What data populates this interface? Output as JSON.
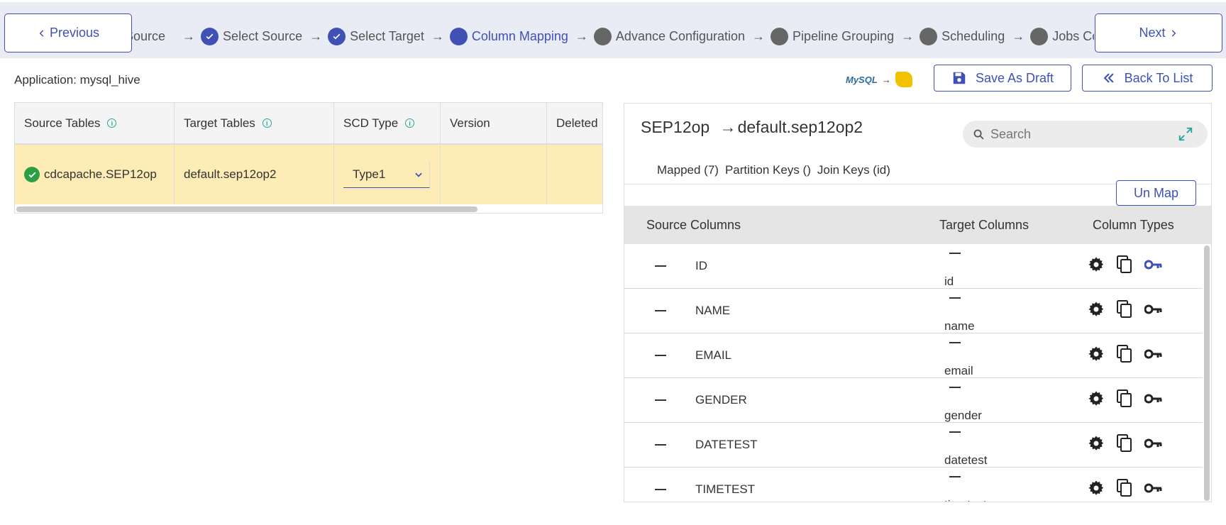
{
  "nav": {
    "previous_label": "Previous",
    "next_label": "Next"
  },
  "steps": [
    {
      "label": "Source",
      "state": "done_partial"
    },
    {
      "label": "Select Source",
      "state": "done"
    },
    {
      "label": "Select Target",
      "state": "done"
    },
    {
      "label": "Column Mapping",
      "state": "active"
    },
    {
      "label": "Advance Configuration",
      "state": "pending"
    },
    {
      "label": "Pipeline Grouping",
      "state": "pending"
    },
    {
      "label": "Scheduling",
      "state": "pending"
    },
    {
      "label": "Jobs Configuration",
      "state": "pending"
    }
  ],
  "header": {
    "application_label": "Application: mysql_hive",
    "logo_mysql": "MySQL",
    "save_draft_label": "Save As Draft",
    "back_label": "Back To List"
  },
  "table": {
    "headers": [
      "Source Tables",
      "Target Tables",
      "SCD Type",
      "Version",
      "Deleted"
    ],
    "row": {
      "source": "cdcapache.SEP12op",
      "target": "default.sep12op2",
      "scd_type": "Type1",
      "version": "",
      "deleted": ""
    }
  },
  "panel": {
    "title_source": "SEP12op",
    "title_target": "default.sep12op2",
    "search_placeholder": "Search",
    "filter_tabs": [
      "Mapped (7)",
      "Partition Keys ()",
      "Join Keys (id)"
    ],
    "unmap_label": "Un Map",
    "column_headers": {
      "source": "Source Columns",
      "target": "Target Columns",
      "types": "Column Types"
    },
    "rows": [
      {
        "source": "ID",
        "target": "id",
        "key_active": true
      },
      {
        "source": "NAME",
        "target": "name",
        "key_active": false
      },
      {
        "source": "EMAIL",
        "target": "email",
        "key_active": false
      },
      {
        "source": "GENDER",
        "target": "gender",
        "key_active": false
      },
      {
        "source": "DATETEST",
        "target": "datetest",
        "key_active": false
      },
      {
        "source": "TIMETEST",
        "target": "timetest",
        "key_active": false
      }
    ]
  },
  "colors": {
    "accent": "#3f51b5",
    "highlight_row": "#fdecb5",
    "success": "#2e9e44",
    "info": "#26a69a"
  }
}
